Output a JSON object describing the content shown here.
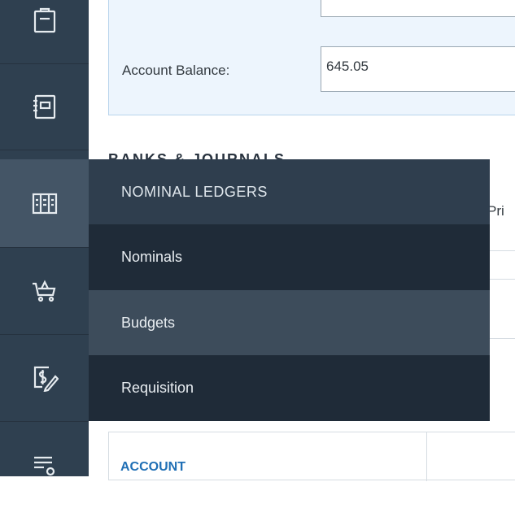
{
  "account": {
    "balance_label": "Account Balance:",
    "balance_value": "645.05"
  },
  "section": {
    "heading_partial": "BANKS & JOURNALS",
    "col_partial": "Pri"
  },
  "table": {
    "col_account": "ACCOUNT"
  },
  "sidebar": {
    "items": [
      {
        "icon": "clipboard-icon"
      },
      {
        "icon": "register-icon"
      },
      {
        "icon": "ledger-columns-icon",
        "active": true
      },
      {
        "icon": "shopping-basket-icon"
      },
      {
        "icon": "dollar-pen-icon"
      },
      {
        "icon": "list-settings-icon"
      }
    ]
  },
  "flyout": {
    "title": "NOMINAL LEDGERS",
    "items": [
      {
        "label": "Nominals"
      },
      {
        "label": "Budgets"
      },
      {
        "label": "Requisition"
      }
    ]
  },
  "colors": {
    "sidebar": "#2f4050",
    "sidebar_active": "#445566",
    "flyout": "#1f2b38",
    "flyout_title": "#2f3e4e",
    "flyout_hover": "#3d4c5b",
    "link": "#1f6fb5",
    "panel": "#edf5fd"
  }
}
